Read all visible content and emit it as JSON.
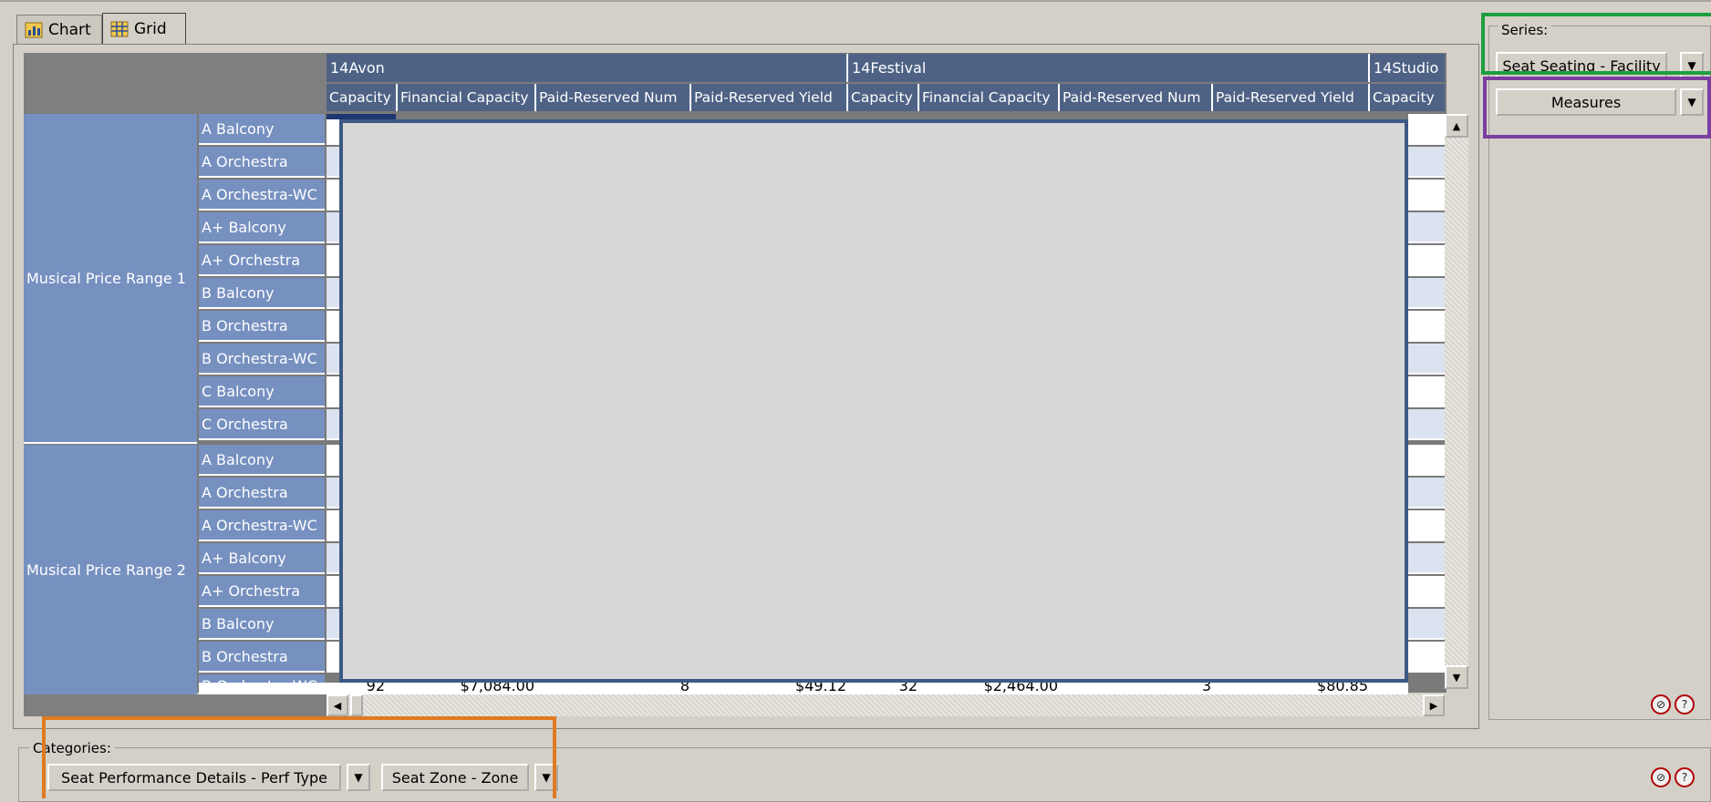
{
  "tabs": [
    {
      "label": "Chart",
      "icon": "chart-icon"
    },
    {
      "label": "Grid",
      "icon": "grid-icon"
    }
  ],
  "grid": {
    "column_groups": [
      "14Avon",
      "14Festival",
      "14Studio"
    ],
    "column_headers": [
      "Capacity",
      "Financial Capacity",
      "Paid-Reserved Num",
      "Paid-Reserved Yield",
      "Capacity",
      "Financial Capacity",
      "Paid-Reserved Num",
      "Paid-Reserved Yield",
      "Capacity"
    ],
    "row_groups": [
      "Musical Price Range 1",
      "Musical Price Range 2"
    ],
    "rows_group1": [
      "A Balcony",
      "A Orchestra",
      "A Orchestra-WC",
      "A+ Balcony",
      "A+ Orchestra",
      "B Balcony",
      "B Orchestra",
      "B Orchestra-WC",
      "C Balcony",
      "C Orchestra"
    ],
    "rows_group2": [
      "A Balcony",
      "A Orchestra",
      "A Orchestra-WC",
      "A+ Balcony",
      "A+ Orchestra",
      "B Balcony",
      "B Orchestra",
      "B Orchestra-WC"
    ],
    "last_row_values": [
      "92",
      "$7,084.00",
      "8",
      "$49.12",
      "32",
      "$2,464.00",
      "3",
      "$80.85"
    ]
  },
  "series": {
    "legend": "Series:",
    "items": [
      "Seat Seating - Facility",
      "Measures"
    ]
  },
  "categories": {
    "legend": "Categories:",
    "items": [
      "Seat Performance Details - Perf Type",
      "Seat Zone - Zone"
    ]
  },
  "colors": {
    "header_blue": "#4e6285",
    "row_blue": "#7690c0",
    "overlay_border": "#3d5a85",
    "highlight_green": "#1f9e3f",
    "highlight_purple": "#7a3ea0",
    "highlight_orange": "#e07a20"
  }
}
